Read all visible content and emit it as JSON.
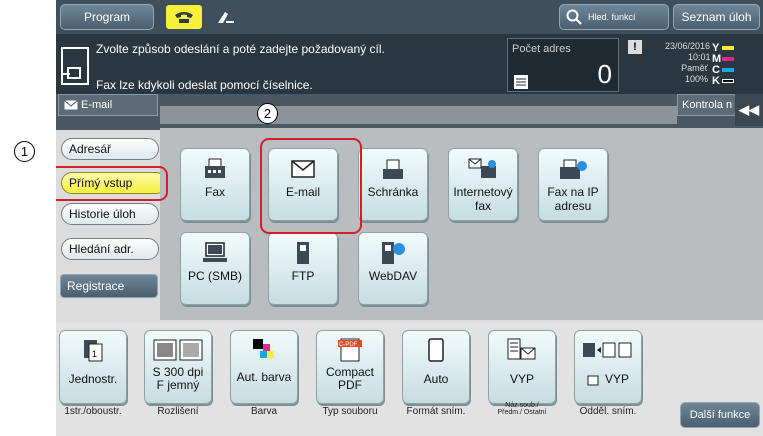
{
  "topbar": {
    "program": "Program",
    "search": "Hled. funkcí",
    "job_list": "Seznam úloh"
  },
  "message": {
    "line1": "Zvolte způsob odeslání a poté zadejte požadovaný cíl.",
    "line2": "Fax lze kdykoli odeslat pomocí číselnice.",
    "count_label": "Počet adres",
    "count_value": "0",
    "date": "23/06/2016",
    "time": "10:01",
    "memory_label": "Paměť",
    "memory_value": "100%",
    "toner": [
      "Y",
      "M",
      "C",
      "K"
    ]
  },
  "tabs": {
    "email": "E-mail",
    "kontrola": "Kontrola n"
  },
  "left_menu": [
    "Adresář",
    "Přímý vstup",
    "Historie úloh",
    "Hledání adr.",
    "Registrace"
  ],
  "tiles": [
    {
      "label": "Fax",
      "icon": "fax-icon"
    },
    {
      "label": "E-mail",
      "icon": "envelope-icon"
    },
    {
      "label": "Schránka",
      "icon": "box-icon"
    },
    {
      "label": "Internetový fax",
      "icon": "internet-fax-icon"
    },
    {
      "label": "Fax na IP adresu",
      "icon": "ip-fax-icon"
    },
    {
      "label": "PC (SMB)",
      "icon": "pc-icon"
    },
    {
      "label": "FTP",
      "icon": "ftp-icon"
    },
    {
      "label": "WebDAV",
      "icon": "webdav-icon"
    }
  ],
  "bottom": [
    {
      "label": "Jednostr.",
      "caption": "1str./oboustr."
    },
    {
      "label": "S 300 dpi F jemný",
      "caption": "Rozlišení"
    },
    {
      "label": "Aut. barva",
      "caption": "Barva"
    },
    {
      "label": "Compact PDF",
      "caption": "Typ souboru",
      "icon_text": "C-PDF"
    },
    {
      "label": "Auto",
      "caption": "Formát sním."
    },
    {
      "label": "VYP",
      "caption": "Náz.soub./ Předm./ Ostatní"
    },
    {
      "label": "VYP",
      "caption": "Odděl. sním."
    }
  ],
  "more_functions": "Další funkce",
  "callouts": [
    "1",
    "2"
  ],
  "colors": {
    "highlight": "#d0202a",
    "accent_yellow": "#f6f03a"
  }
}
